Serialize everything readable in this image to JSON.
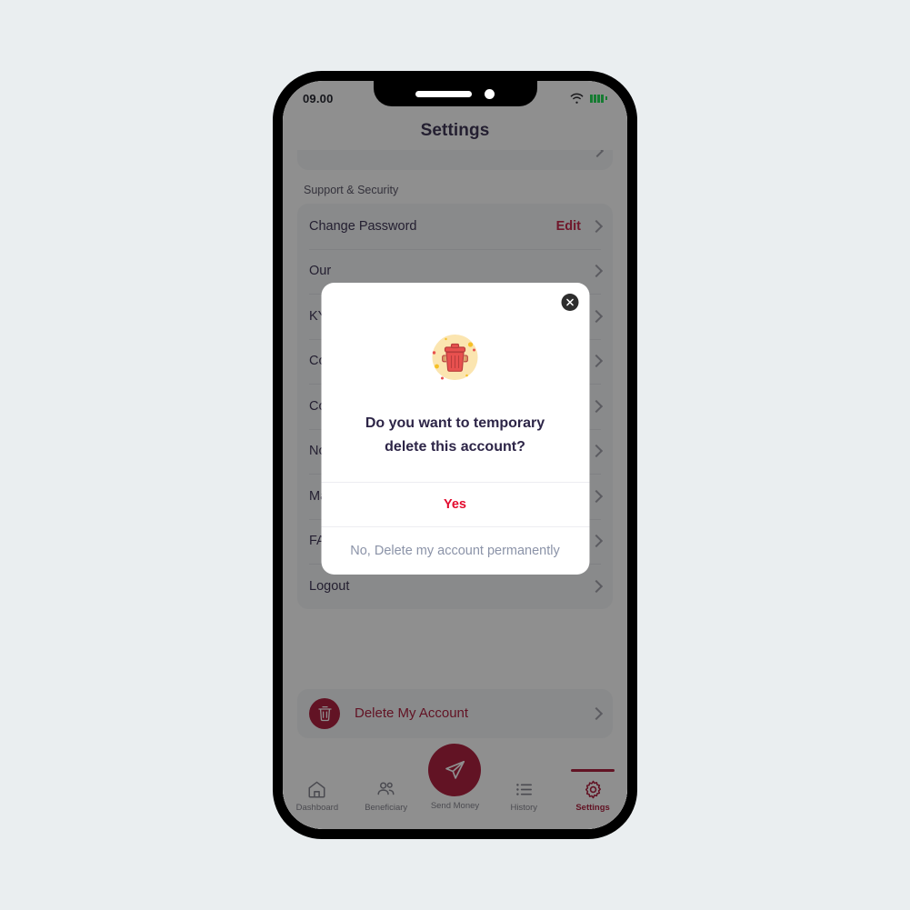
{
  "status_bar": {
    "time": "09.00",
    "wifi_icon": "wifi-icon",
    "battery_icon": "battery-icon",
    "battery_color": "#12d94a"
  },
  "header": {
    "title": "Settings"
  },
  "settings": {
    "section_label": "Support & Security",
    "rows": [
      {
        "label": "Change Password",
        "action": "Edit"
      },
      {
        "label": "Our",
        "action": ""
      },
      {
        "label": "KYC",
        "action": ""
      },
      {
        "label": "Cor",
        "action": ""
      },
      {
        "label": "Cor",
        "action": ""
      },
      {
        "label": "Not",
        "action": ""
      },
      {
        "label": "Mar",
        "action": ""
      },
      {
        "label": "FAQ",
        "action": ""
      },
      {
        "label": "Logout",
        "action": ""
      }
    ],
    "delete_account": {
      "label": "Delete My Account",
      "icon": "trash-icon",
      "color": "#a70d2e"
    }
  },
  "modal": {
    "close_icon": "close-icon",
    "illustration_icon": "trash-can-illustration",
    "message": "Do you want to temporary delete this account?",
    "yes_label": "Yes",
    "no_label": "No, Delete my account permanently",
    "yes_color": "#e30b2e",
    "no_color": "#8b93a8"
  },
  "bottom_nav": {
    "items": [
      {
        "label": "Dashboard",
        "icon": "home-icon",
        "active": false
      },
      {
        "label": "Beneficiary",
        "icon": "people-icon",
        "active": false
      },
      {
        "label": "Send Money",
        "icon": "send-plane-icon",
        "active": false
      },
      {
        "label": "History",
        "icon": "list-icon",
        "active": false
      },
      {
        "label": "Settings",
        "icon": "gear-icon",
        "active": true
      }
    ],
    "active_color": "#a70d2e"
  }
}
